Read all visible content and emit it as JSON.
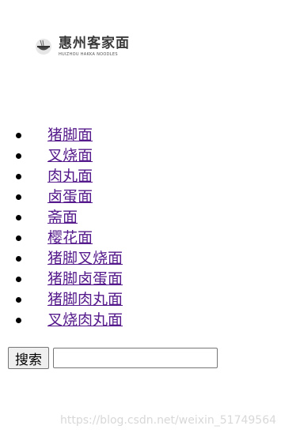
{
  "logo": {
    "title": "惠州客家面",
    "subtitle": "HUIZHOU HAKKA NOODLES",
    "icon": "noodle-bowl-icon"
  },
  "menu": {
    "items": [
      "猪脚面",
      "叉烧面",
      "肉丸面",
      "卤蛋面",
      "斋面",
      "樱花面",
      "猪脚叉烧面",
      "猪脚卤蛋面",
      "猪脚肉丸面",
      "叉烧肉丸面"
    ],
    "link_color": "#551a8b"
  },
  "search": {
    "button_label": "搜索",
    "input_value": ""
  },
  "watermark": "https://blog.csdn.net/weixin_51749564"
}
